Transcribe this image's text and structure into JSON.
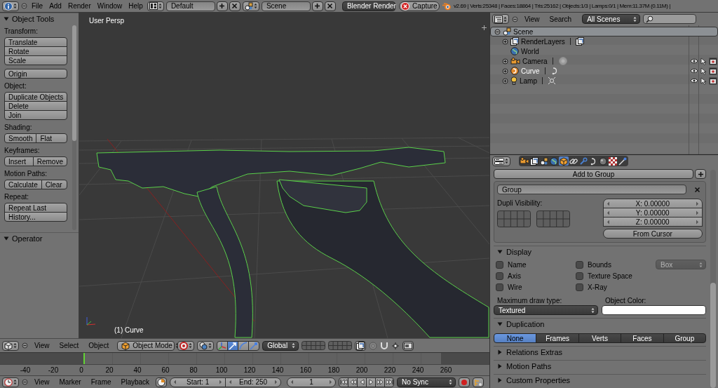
{
  "info_header": {
    "menus": [
      "File",
      "Add",
      "Render",
      "Window",
      "Help"
    ],
    "screen_layout": "Default",
    "scene": "Scene",
    "render_engine": "Blender Render",
    "capture": "Capture",
    "stats": "v2.69 | Verts:25348 | Faces:18864 | Tris:25162 | Objects:1/3 | Lamps:0/1 | Mem:11.37M (0.11M) |"
  },
  "tool_shelf": {
    "panels": [
      {
        "title": "Object Tools",
        "expanded": true,
        "groups": [
          {
            "label": "Transform:",
            "rows": [
              [
                "Translate"
              ],
              [
                "Rotate"
              ],
              [
                "Scale"
              ]
            ]
          },
          {
            "rows": [
              [
                "Origin"
              ]
            ]
          },
          {
            "label": "Object:",
            "rows": [
              [
                "Duplicate Objects"
              ],
              [
                "Delete"
              ],
              [
                "Join"
              ]
            ]
          },
          {
            "label": "Shading:",
            "rows": [
              [
                "Smooth",
                "Flat"
              ]
            ]
          },
          {
            "label": "Keyframes:",
            "rows": [
              [
                "Insert",
                "Remove"
              ]
            ]
          },
          {
            "label": "Motion Paths:",
            "rows": [
              [
                "Calculate",
                "Clear"
              ]
            ]
          },
          {
            "label": "Repeat:",
            "rows": [
              [
                "Repeat Last"
              ],
              [
                "History..."
              ]
            ]
          }
        ]
      },
      {
        "title": "Operator",
        "expanded": true
      }
    ]
  },
  "viewport": {
    "view_label": "User Persp",
    "object_label": "(1) Curve"
  },
  "view3d_header": {
    "menus": [
      "View",
      "Select",
      "Object"
    ],
    "mode": "Object Mode",
    "orientation": "Global"
  },
  "timeline": {
    "ruler": [
      "-40",
      "-20",
      "0",
      "20",
      "40",
      "60",
      "80",
      "100",
      "120",
      "140",
      "160",
      "180",
      "200",
      "220",
      "240",
      "260"
    ]
  },
  "timeline_header": {
    "menus": [
      "View",
      "Marker",
      "Frame",
      "Playback"
    ],
    "start": "Start: 1",
    "end": "End: 250",
    "current_frame": "1",
    "sync": "No Sync"
  },
  "outliner": {
    "menus": [
      "View",
      "Search"
    ],
    "filter": "All Scenes",
    "tree": [
      {
        "name": "Scene",
        "kind": "scene",
        "expanded": true,
        "selected": true,
        "active": false,
        "restrict_toggles": false,
        "children": [
          {
            "name": "RenderLayers",
            "kind": "render_layers",
            "expanded": false,
            "selected": false,
            "active": false,
            "restrict_toggles": false
          },
          {
            "name": "World",
            "kind": "world",
            "selected": false,
            "active": false,
            "restrict_toggles": false
          },
          {
            "name": "Camera",
            "kind": "camera",
            "expanded": false,
            "selected": false,
            "active": false,
            "restrict_toggles": true
          },
          {
            "name": "Curve",
            "kind": "curve",
            "expanded": false,
            "selected": false,
            "active": true,
            "restrict_toggles": true
          },
          {
            "name": "Lamp",
            "kind": "lamp",
            "expanded": false,
            "selected": false,
            "active": false,
            "restrict_toggles": true
          }
        ]
      }
    ]
  },
  "properties": {
    "tabs": [
      {
        "kind": "render",
        "selected": false
      },
      {
        "kind": "render_layers",
        "selected": false
      },
      {
        "kind": "scene",
        "selected": false
      },
      {
        "kind": "world",
        "selected": false
      },
      {
        "kind": "object",
        "selected": true
      },
      {
        "kind": "constraints",
        "selected": false
      },
      {
        "kind": "modifiers",
        "selected": false
      },
      {
        "kind": "data",
        "selected": false
      },
      {
        "kind": "material",
        "selected": false
      },
      {
        "kind": "texture",
        "selected": false
      },
      {
        "kind": "physics",
        "selected": false
      }
    ],
    "add_to_group": "Add to Group",
    "group": {
      "name": "Group",
      "dupli_label": "Dupli Visibility:",
      "offset": [
        "X: 0.00000",
        "Y: 0.00000",
        "Z: 0.00000"
      ],
      "from_cursor": "From Cursor"
    },
    "display": {
      "title": "Display",
      "expanded": true,
      "checkboxes": [
        {
          "label": "Name",
          "checked": false
        },
        {
          "label": "Axis",
          "checked": false
        },
        {
          "label": "Wire",
          "checked": false
        },
        {
          "label": "Bounds",
          "checked": false
        },
        {
          "label": "Texture Space",
          "checked": false
        },
        {
          "label": "X-Ray",
          "checked": false
        }
      ],
      "bounds_type": {
        "value": "Box",
        "disabled": true
      },
      "draw_type_label": "Maximum draw type:",
      "draw_type": "Textured",
      "color_label": "Object Color:"
    },
    "duplication": {
      "title": "Duplication",
      "expanded": true,
      "options": [
        {
          "label": "None",
          "selected": true
        },
        {
          "label": "Frames",
          "selected": false
        },
        {
          "label": "Verts",
          "selected": false
        },
        {
          "label": "Faces",
          "selected": false
        },
        {
          "label": "Group",
          "selected": false
        }
      ]
    },
    "collapsed_panels": [
      {
        "title": "Relations Extras",
        "expanded": false
      },
      {
        "title": "Motion Paths",
        "expanded": false
      },
      {
        "title": "Custom Properties",
        "expanded": false
      }
    ]
  }
}
